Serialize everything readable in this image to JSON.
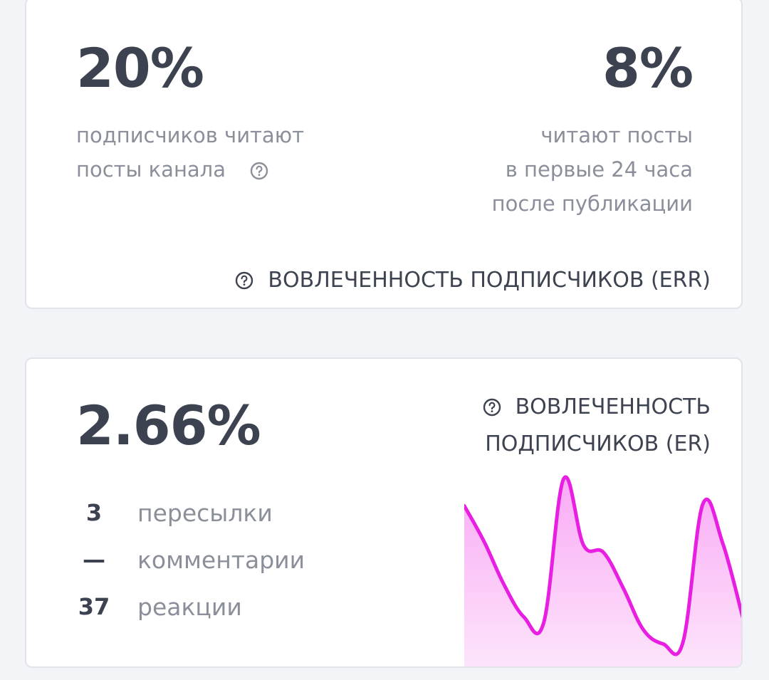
{
  "err_card": {
    "read_share": "20%",
    "read_share_desc_line1": "подписчиков читают",
    "read_share_desc_line2": "посты канала",
    "read_24h": "8%",
    "read_24h_desc_line1": "читают посты",
    "read_24h_desc_line2": "в первые 24 часа",
    "read_24h_desc_line3": "после публикации",
    "footer_title": "ВОВЛЕЧЕННОСТЬ ПОДПИСЧИКОВ (ERR)"
  },
  "er_card": {
    "er_value": "2.66%",
    "title_line1": "ВОВЛЕЧЕННОСТЬ",
    "title_line2": "ПОДПИСЧИКОВ (ER)",
    "stats": [
      {
        "value": "3",
        "label": "пересылки"
      },
      {
        "value": "—",
        "label": "комментарии"
      },
      {
        "value": "37",
        "label": "реакции"
      }
    ],
    "sparkline_color": "#e81ee3",
    "sparkline_fill_top": "#f9aaf5",
    "sparkline_fill_bottom": "#fde4fb",
    "sparkline_points": [
      0.84,
      0.64,
      0.4,
      0.22,
      0.19,
      0.99,
      0.62,
      0.58,
      0.38,
      0.15,
      0.07,
      0.08,
      0.85,
      0.63,
      0.22
    ]
  },
  "icons": {
    "help": "question-circle-icon"
  }
}
